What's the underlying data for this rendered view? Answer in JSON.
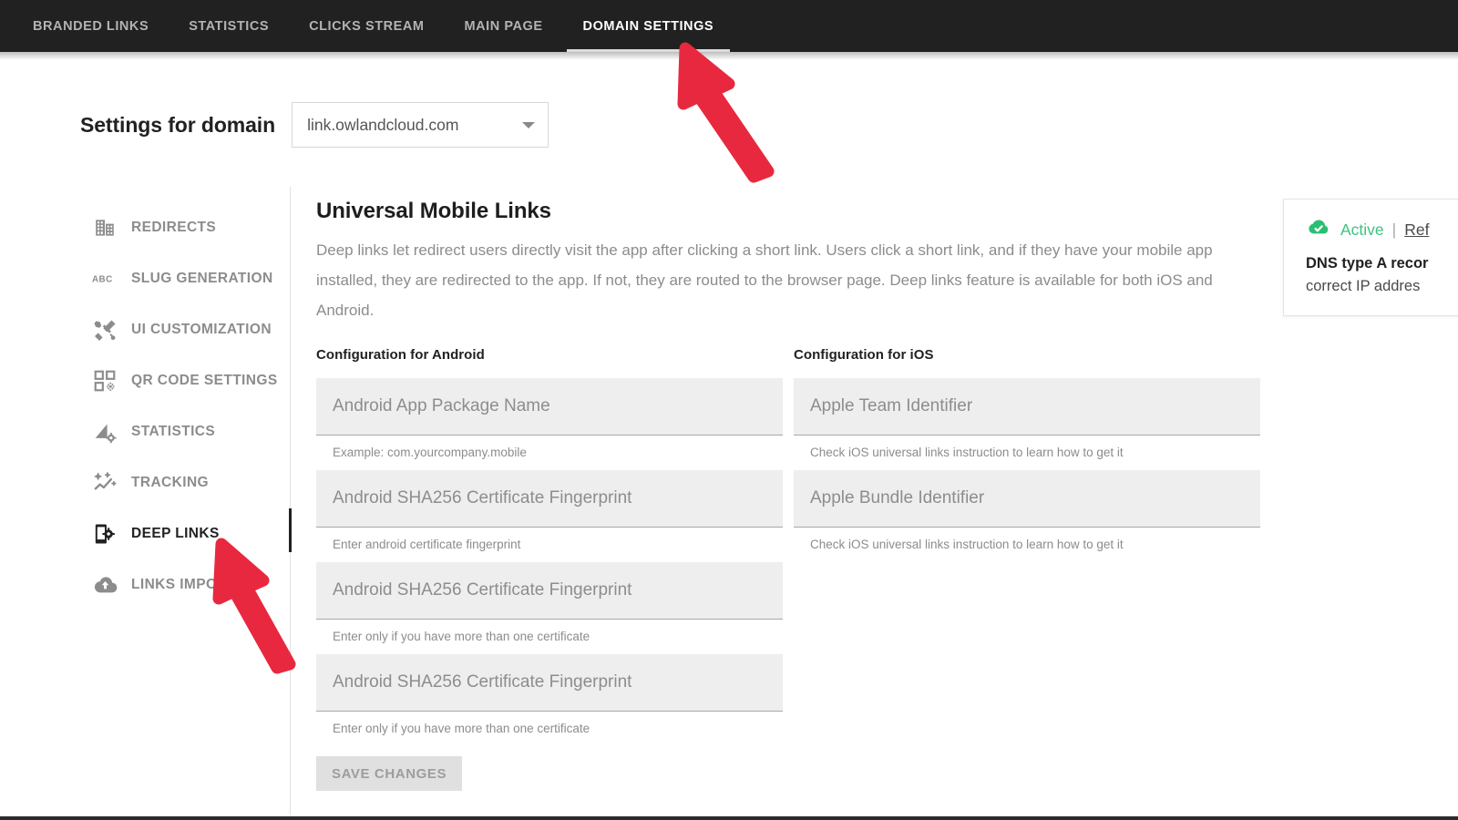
{
  "topnav": {
    "tabs": [
      {
        "label": "BRANDED LINKS",
        "active": false
      },
      {
        "label": "STATISTICS",
        "active": false
      },
      {
        "label": "CLICKS STREAM",
        "active": false
      },
      {
        "label": "MAIN PAGE",
        "active": false
      },
      {
        "label": "DOMAIN SETTINGS",
        "active": true
      }
    ]
  },
  "domain": {
    "label": "Settings for domain",
    "selected": "link.owlandcloud.com",
    "caret_icon": "chevron-down-icon"
  },
  "sidebar": {
    "items": [
      {
        "label": "REDIRECTS",
        "icon": "building-redirect-icon",
        "active": false
      },
      {
        "label": "SLUG GENERATION",
        "icon": "abc-icon",
        "active": false
      },
      {
        "label": "UI CUSTOMIZATION",
        "icon": "brush-wrench-icon",
        "active": false
      },
      {
        "label": "QR CODE SETTINGS",
        "icon": "qr-code-icon",
        "active": false
      },
      {
        "label": "STATISTICS",
        "icon": "chart-gear-icon",
        "active": false
      },
      {
        "label": "TRACKING",
        "icon": "tracking-line-icon",
        "active": false
      },
      {
        "label": "DEEP LINKS",
        "icon": "mobile-gear-icon",
        "active": true
      },
      {
        "label": "LINKS IMPORT",
        "icon": "cloud-upload-icon",
        "active": false
      }
    ]
  },
  "main": {
    "title": "Universal Mobile Links",
    "description": "Deep links let redirect users directly visit the app after clicking a short link. Users click a short link, and if they have your mobile app installed, they are redirected to the app. If not, they are routed to the browser page. Deep links feature is available for both iOS and Android.",
    "android": {
      "heading": "Configuration for Android",
      "fields": [
        {
          "placeholder": "Android App Package Name",
          "value": "",
          "hint": "Example: com.yourcompany.mobile"
        },
        {
          "placeholder": "Android SHA256 Certificate Fingerprint",
          "value": "",
          "hint": "Enter android certificate fingerprint"
        },
        {
          "placeholder": "Android SHA256 Certificate Fingerprint",
          "value": "",
          "hint": "Enter only if you have more than one certificate"
        },
        {
          "placeholder": "Android SHA256 Certificate Fingerprint",
          "value": "",
          "hint": "Enter only if you have more than one certificate"
        }
      ],
      "save_label": "SAVE CHANGES"
    },
    "ios": {
      "heading": "Configuration for iOS",
      "fields": [
        {
          "placeholder": "Apple Team Identifier",
          "value": "",
          "hint": "Check iOS universal links instruction to learn how to get it"
        },
        {
          "placeholder": "Apple Bundle Identifier",
          "value": "",
          "hint": "Check iOS universal links instruction to learn how to get it"
        }
      ]
    }
  },
  "status_panel": {
    "icon": "cloud-check-icon",
    "state": "Active",
    "separator": "|",
    "refresh_label": "Ref",
    "line1": "DNS type A recor",
    "line2": "correct IP addres"
  },
  "annotations": {
    "arrows": [
      {
        "name": "arrow-to-domain-settings-tab",
        "color": "#e8283f"
      },
      {
        "name": "arrow-to-deep-links-item",
        "color": "#e8283f"
      }
    ]
  },
  "colors": {
    "topbar_bg": "#212121",
    "accent_green": "#3ec27f",
    "arrow_red": "#e8283f",
    "field_bg": "#eeeeee",
    "muted_text": "#8c8c8c"
  }
}
